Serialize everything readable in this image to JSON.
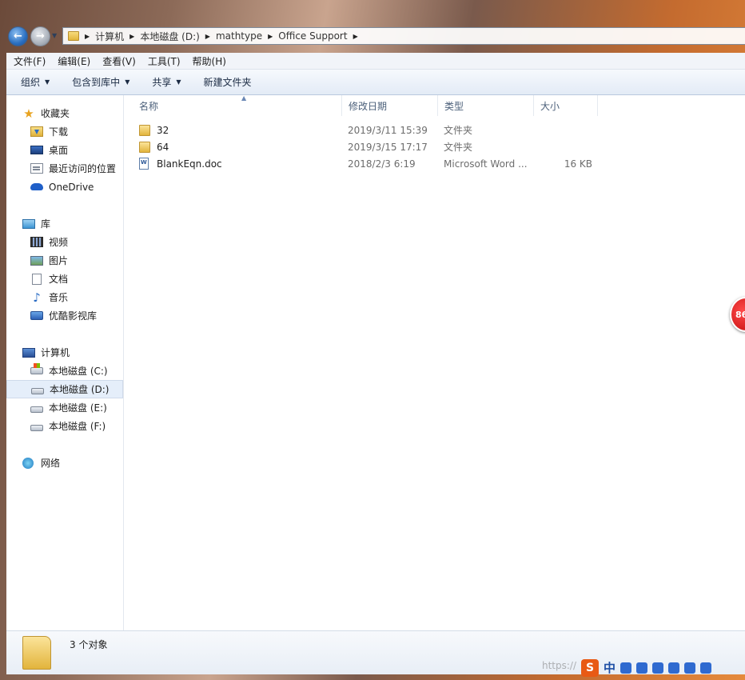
{
  "address_bar": {
    "breadcrumbs": [
      "计算机",
      "本地磁盘 (D:)",
      "mathtype",
      "Office Support"
    ]
  },
  "menubar": {
    "items": [
      "文件(F)",
      "编辑(E)",
      "查看(V)",
      "工具(T)",
      "帮助(H)"
    ]
  },
  "toolbar": {
    "organize": "组织",
    "include_in_library": "包含到库中",
    "share": "共享",
    "new_folder": "新建文件夹"
  },
  "sidebar": {
    "favorites": {
      "label": "收藏夹",
      "items": [
        "下载",
        "桌面",
        "最近访问的位置",
        "OneDrive"
      ]
    },
    "libraries": {
      "label": "库",
      "items": [
        "视频",
        "图片",
        "文档",
        "音乐",
        "优酷影视库"
      ]
    },
    "computer": {
      "label": "计算机",
      "items": [
        "本地磁盘 (C:)",
        "本地磁盘 (D:)",
        "本地磁盘 (E:)",
        "本地磁盘 (F:)"
      ],
      "selected": "本地磁盘 (D:)"
    },
    "network": {
      "label": "网络"
    }
  },
  "file_list": {
    "columns": [
      "名称",
      "修改日期",
      "类型",
      "大小"
    ],
    "rows": [
      {
        "name": "32",
        "modified": "2019/3/11 15:39",
        "type": "文件夹",
        "size": "",
        "icon": "folder-icon"
      },
      {
        "name": "64",
        "modified": "2019/3/15 17:17",
        "type": "文件夹",
        "size": "",
        "icon": "folder-icon"
      },
      {
        "name": "BlankEqn.doc",
        "modified": "2018/2/3 6:19",
        "type": "Microsoft Word ...",
        "size": "16 KB",
        "icon": "word-document-icon"
      }
    ]
  },
  "status_bar": {
    "text": "3 个对象"
  },
  "overlay": {
    "badge": "86",
    "ime_logo": "S",
    "ime_mode": "中",
    "watermark": "https://"
  },
  "colors": {
    "selection": "#e5eefa",
    "toolbar_bg": "#e3ebf6",
    "badge": "#d41414"
  }
}
